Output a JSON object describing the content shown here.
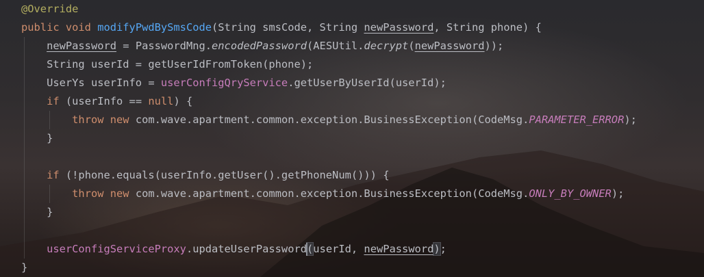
{
  "editor": {
    "lines": [
      {
        "indent": 0,
        "tokens": [
          {
            "t": "@Override",
            "c": "ann"
          }
        ]
      },
      {
        "indent": 0,
        "tokens": [
          {
            "t": "public ",
            "c": "kw"
          },
          {
            "t": "void ",
            "c": "kw"
          },
          {
            "t": "modifyPwdBySmsCode",
            "c": "fn"
          },
          {
            "t": "(String smsCode, String "
          },
          {
            "t": "newPassword",
            "c": "ul"
          },
          {
            "t": ", String phone) {"
          }
        ]
      },
      {
        "indent": 1,
        "tokens": [
          {
            "t": "newPassword",
            "c": "ul"
          },
          {
            "t": " = PasswordMng."
          },
          {
            "t": "encodedPassword",
            "c": "italic"
          },
          {
            "t": "(AESUtil."
          },
          {
            "t": "decrypt",
            "c": "italic"
          },
          {
            "t": "("
          },
          {
            "t": "newPassword",
            "c": "ul"
          },
          {
            "t": "));"
          }
        ]
      },
      {
        "indent": 1,
        "tokens": [
          {
            "t": "String userId = getUserIdFromToken(phone);"
          }
        ]
      },
      {
        "indent": 1,
        "tokens": [
          {
            "t": "UserYs userInfo = "
          },
          {
            "t": "userConfigQryService",
            "c": "field"
          },
          {
            "t": ".getUserByUserId(userId);"
          }
        ]
      },
      {
        "indent": 1,
        "tokens": [
          {
            "t": "if ",
            "c": "kw"
          },
          {
            "t": "(userInfo == "
          },
          {
            "t": "null",
            "c": "kw"
          },
          {
            "t": ") {"
          }
        ]
      },
      {
        "indent": 2,
        "tokens": [
          {
            "t": "throw ",
            "c": "kw"
          },
          {
            "t": "new ",
            "c": "kw"
          },
          {
            "t": "com.wave.apartment.common.exception.BusinessException(CodeMsg."
          },
          {
            "t": "PARAMETER_ERROR",
            "c": "field italic"
          },
          {
            "t": ");"
          }
        ]
      },
      {
        "indent": 1,
        "tokens": [
          {
            "t": "}"
          }
        ]
      },
      {
        "indent": 1,
        "tokens": []
      },
      {
        "indent": 1,
        "tokens": [
          {
            "t": "if ",
            "c": "kw"
          },
          {
            "t": "(!phone.equals(userInfo.getUser().getPhoneNum())) {"
          }
        ]
      },
      {
        "indent": 2,
        "tokens": [
          {
            "t": "throw ",
            "c": "kw"
          },
          {
            "t": "new ",
            "c": "kw"
          },
          {
            "t": "com.wave.apartment.common.exception.BusinessException(CodeMsg."
          },
          {
            "t": "ONLY_BY_OWNER",
            "c": "field italic"
          },
          {
            "t": ");"
          }
        ]
      },
      {
        "indent": 1,
        "tokens": [
          {
            "t": "}"
          }
        ]
      },
      {
        "indent": 1,
        "tokens": []
      },
      {
        "indent": 1,
        "tokens": [
          {
            "t": "userConfigServiceProxy",
            "c": "field"
          },
          {
            "t": ".updateUserPassword"
          },
          {
            "t": "(",
            "c": "caret-match"
          },
          {
            "t": "userId, "
          },
          {
            "t": "newPassword",
            "c": "ul"
          },
          {
            "t": ")",
            "c": "caret-match"
          },
          {
            "t": ";"
          }
        ]
      },
      {
        "indent": 0,
        "tokens": [
          {
            "t": "}"
          }
        ]
      }
    ],
    "caret_after_token": {
      "line": 13,
      "token": 1
    }
  }
}
